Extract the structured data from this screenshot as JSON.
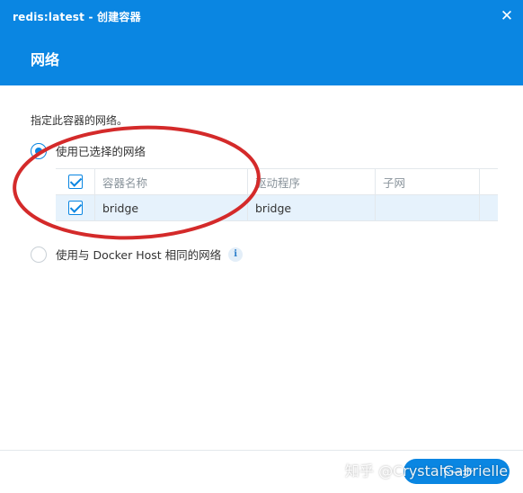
{
  "window": {
    "title": "redis:latest - 创建容器",
    "close_glyph": "✕"
  },
  "page": {
    "title": "网络",
    "description": "指定此容器的网络。"
  },
  "options": {
    "selected_network_label": "使用已选择的网络",
    "host_network_label": "使用与 Docker Host 相同的网络",
    "info_glyph": "i"
  },
  "table": {
    "headers": [
      "容器名称",
      "驱动程序",
      "子网"
    ],
    "rows": [
      {
        "checked": true,
        "name": "bridge",
        "driver": "bridge",
        "subnet": ""
      }
    ]
  },
  "footer": {
    "next_label": "下一步"
  },
  "watermark": "知乎 @CrystalGabrielle",
  "colors": {
    "accent": "#0a86e2",
    "annotation_circle": "#d42a2a",
    "selected_row": "#e6f2fc"
  }
}
